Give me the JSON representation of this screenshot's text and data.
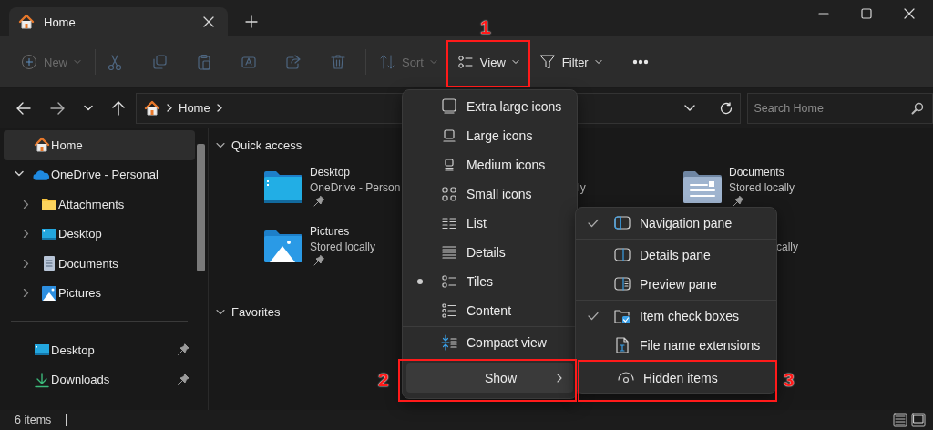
{
  "tabs": [
    {
      "label": "Home",
      "selected": true
    }
  ],
  "toolbar": {
    "items": [
      {
        "kind": "button",
        "label": "New",
        "disabled": true,
        "dropdown": true
      },
      {
        "kind": "separator"
      },
      {
        "kind": "icon",
        "disabled": true
      },
      {
        "kind": "icon",
        "disabled": true
      },
      {
        "kind": "icon",
        "disabled": true
      },
      {
        "kind": "icon",
        "disabled": true
      },
      {
        "kind": "icon",
        "disabled": true
      },
      {
        "kind": "icon",
        "disabled": true
      },
      {
        "kind": "separator"
      },
      {
        "kind": "button",
        "label": "Sort",
        "disabled": true,
        "dropdown": true
      },
      {
        "kind": "button",
        "label": "View",
        "disabled": false,
        "dropdown": true
      },
      {
        "kind": "button",
        "label": "Filter",
        "disabled": false,
        "dropdown": true
      },
      {
        "kind": "icon",
        "disabled": false
      }
    ]
  },
  "address": {
    "path": [
      "Home"
    ]
  },
  "search": {
    "placeholder": "Search Home"
  },
  "sidebar": {
    "items": [
      {
        "label": "Home",
        "selected": true
      },
      {
        "label": "OneDrive - Personal",
        "selected": false,
        "expanded": true,
        "children": [
          {
            "label": "Attachments",
            "selected": false,
            "expanded": false
          },
          {
            "label": "Desktop",
            "selected": false,
            "expanded": false
          },
          {
            "label": "Documents",
            "selected": false,
            "expanded": false
          },
          {
            "label": "Pictures",
            "selected": false,
            "expanded": false
          }
        ]
      }
    ],
    "pinned": [
      {
        "label": "Desktop",
        "pinned": true
      },
      {
        "label": "Downloads",
        "pinned": true
      }
    ]
  },
  "main": {
    "sections": [
      {
        "title": "Quick access",
        "expanded": true,
        "tiles": [
          {
            "kind": "folder",
            "name": "Desktop",
            "detail": "OneDrive - Person",
            "pinned": true
          },
          {
            "kind": "fragment",
            "text": "ly"
          },
          {
            "kind": "folder",
            "name": "Documents",
            "detail": "Stored locally",
            "pinned": true
          },
          {
            "kind": "folder",
            "name": "Pictures",
            "detail": "Stored locally",
            "pinned": true
          },
          {
            "kind": "hidden"
          },
          {
            "kind": "fragment",
            "text": "cally"
          }
        ]
      },
      {
        "title": "Favorites",
        "expanded": true
      }
    ]
  },
  "status_bar": {
    "count": "6 items"
  },
  "view_menu": {
    "items": [
      {
        "kind": "layout",
        "label": "Extra large icons",
        "selected": false
      },
      {
        "kind": "layout",
        "label": "Large icons",
        "selected": false
      },
      {
        "kind": "layout",
        "label": "Medium icons",
        "selected": false
      },
      {
        "kind": "layout",
        "label": "Small icons",
        "selected": false
      },
      {
        "kind": "layout",
        "label": "List",
        "selected": false
      },
      {
        "kind": "layout",
        "label": "Details",
        "selected": false
      },
      {
        "kind": "layout",
        "label": "Tiles",
        "selected": true
      },
      {
        "kind": "layout",
        "label": "Content",
        "selected": false
      },
      {
        "kind": "separator"
      },
      {
        "kind": "toggle",
        "label": "Compact view",
        "checked": false
      },
      {
        "kind": "submenu",
        "label": "Show",
        "highlighted": true
      }
    ]
  },
  "show_menu": {
    "items": [
      {
        "kind": "toggle",
        "label": "Navigation pane",
        "checked": true
      },
      {
        "kind": "separator"
      },
      {
        "kind": "toggle",
        "label": "Details pane",
        "checked": false
      },
      {
        "kind": "toggle",
        "label": "Preview pane",
        "checked": false
      },
      {
        "kind": "separator"
      },
      {
        "kind": "toggle",
        "label": "Item check boxes",
        "checked": true
      },
      {
        "kind": "toggle",
        "label": "File name extensions",
        "checked": false
      },
      {
        "kind": "toggle",
        "label": "Hidden items",
        "checked": false
      }
    ]
  },
  "annotations": [
    {
      "label": "1"
    },
    {
      "label": "2"
    },
    {
      "label": "3"
    }
  ]
}
